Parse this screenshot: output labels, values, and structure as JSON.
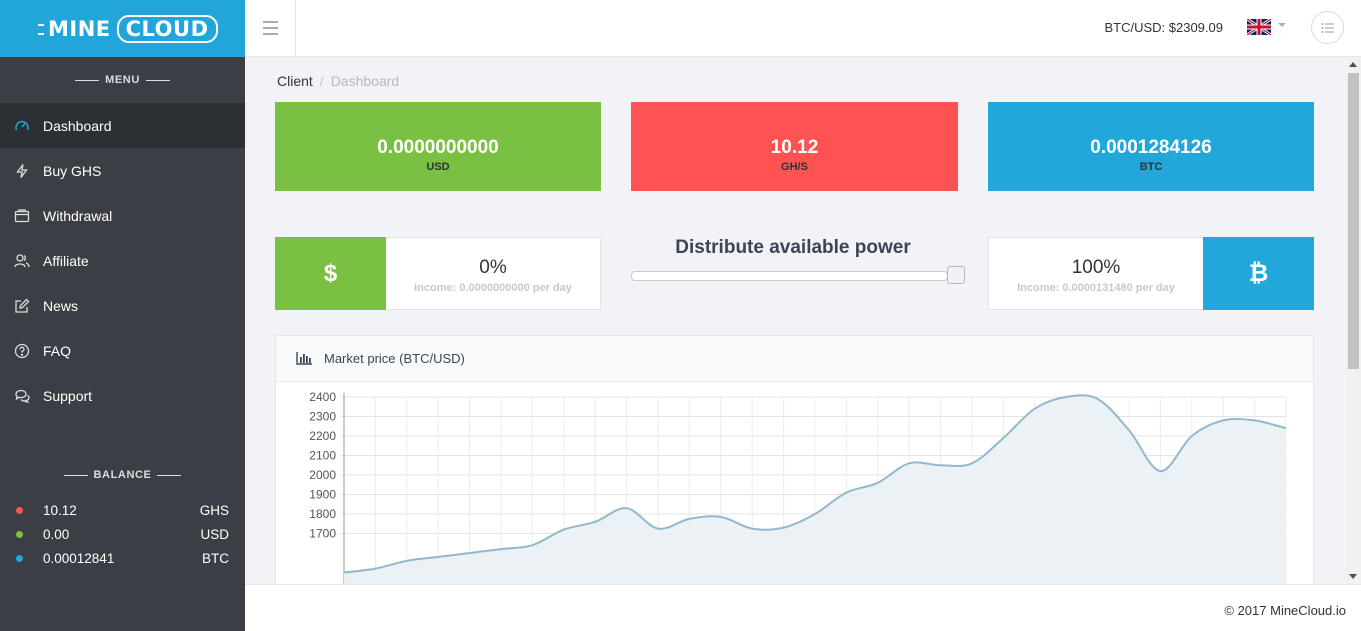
{
  "logo": {
    "part1": "MINE",
    "part2": "CLOUD"
  },
  "sidebar": {
    "menu_title": "MENU",
    "items": [
      {
        "label": "Dashboard",
        "icon": "dashboard-icon",
        "active": true
      },
      {
        "label": "Buy GHS",
        "icon": "bolt-icon"
      },
      {
        "label": "Withdrawal",
        "icon": "wallet-icon"
      },
      {
        "label": "Affiliate",
        "icon": "users-icon"
      },
      {
        "label": "News",
        "icon": "edit-icon"
      },
      {
        "label": "FAQ",
        "icon": "question-icon"
      },
      {
        "label": "Support",
        "icon": "chat-icon"
      }
    ],
    "balance_title": "BALANCE",
    "balance": [
      {
        "value": "10.12",
        "unit": "GHS",
        "color": "#fe5352"
      },
      {
        "value": "0.00",
        "unit": "USD",
        "color": "#7ac143"
      },
      {
        "value": "0.00012841",
        "unit": "BTC",
        "color": "#21a7d9"
      }
    ]
  },
  "topbar": {
    "ticker": "BTC/USD: $2309.09",
    "flag_icon": "uk-flag-icon"
  },
  "breadcrumb": {
    "root": "Client",
    "separator": "/",
    "current": "Dashboard"
  },
  "stats": [
    {
      "value": "0.0000000000",
      "unit": "USD",
      "color": "#7ac143"
    },
    {
      "value": "10.12",
      "unit": "GH/S",
      "color": "#fe5352"
    },
    {
      "value": "0.0001284126",
      "unit": "BTC",
      "color": "#21a7d9"
    }
  ],
  "distribute": {
    "title": "Distribute available power",
    "slider_fraction": 1.0,
    "usd": {
      "icon_glyph": "$",
      "percent": "0%",
      "income": "Income: 0.0000000000 per day"
    },
    "btc": {
      "icon_glyph": "₿",
      "percent": "100%",
      "income": "Income: 0.0000131480 per day"
    }
  },
  "chart_panel": {
    "title": "Market price (BTC/USD)"
  },
  "chart_data": {
    "type": "area",
    "title": "",
    "ylim": [
      1700,
      2400
    ],
    "yticks": [
      1700,
      1800,
      1900,
      2000,
      2100,
      2200,
      2300,
      2400
    ],
    "x": [
      0,
      1,
      2,
      3,
      4,
      5,
      6,
      7,
      8,
      9,
      10,
      11,
      12,
      13,
      14,
      15,
      16,
      17,
      18,
      19,
      20,
      21,
      22,
      23,
      24,
      25,
      26,
      27,
      28,
      29,
      30
    ],
    "values": [
      1500,
      1520,
      1560,
      1580,
      1600,
      1620,
      1640,
      1720,
      1760,
      1830,
      1725,
      1775,
      1785,
      1725,
      1730,
      1800,
      1910,
      1960,
      2060,
      2050,
      2060,
      2190,
      2340,
      2400,
      2390,
      2230,
      2020,
      2200,
      2280,
      2280,
      2240
    ],
    "grid": true,
    "series_color": "#93b8cc",
    "fill_color": "#e9f0f4"
  },
  "footer": {
    "text": "© 2017 MineCloud.io"
  }
}
